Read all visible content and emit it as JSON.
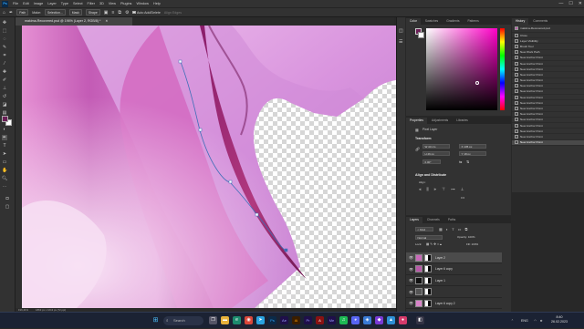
{
  "app": {
    "logo": "Ps"
  },
  "menu": [
    "File",
    "Edit",
    "Image",
    "Layer",
    "Type",
    "Select",
    "Filter",
    "3D",
    "View",
    "Plugins",
    "Window",
    "Help"
  ],
  "window_controls": {
    "minimize": "—",
    "maximize": "☐",
    "close": "✕"
  },
  "options_bar": {
    "tool_mode": "Path",
    "make_label": "Make:",
    "selection_btn": "Selection...",
    "mask_btn": "Mask",
    "shape_btn": "Shape",
    "auto_add_delete": "Auto Add/Delete",
    "align_edges": "Align Edges"
  },
  "document": {
    "tab_title": "makima-Recovered.psd @ 196% (Layer 2, RGB/8) *",
    "close": "✕"
  },
  "status_bar": {
    "zoom": "196,41%",
    "doc_info": "1863 px x 1613 px (72 ppi)"
  },
  "color_panel": {
    "tabs": [
      "Color",
      "Swatches",
      "Gradients",
      "Patterns"
    ],
    "foreground_color": "#6b1f57",
    "background_color": "#ffffff"
  },
  "history_panel": {
    "tabs": [
      "History",
      "Comments"
    ],
    "snapshot": "makima-Recovered.psd",
    "items": [
      "Close",
      "Layer Visibility",
      "Brush Tool",
      "New Work Path",
      "New Anchor Point",
      "New Anchor Point",
      "New Anchor Point",
      "New Anchor Point",
      "New Anchor Point",
      "New Anchor Point",
      "New Anchor Point",
      "New Anchor Point",
      "New Anchor Point",
      "New Anchor Point",
      "New Anchor Point",
      "New Anchor Point",
      "New Anchor Point",
      "New Anchor Point",
      "New Anchor Point",
      "New Anchor Point"
    ],
    "selected_index": 19
  },
  "properties_panel": {
    "tabs": [
      "Properties",
      "Adjustments",
      "Libraries"
    ],
    "layer_type": "Pixel Layer",
    "transform_label": "Transform",
    "w": "W 43 cm",
    "x": "X 135 px",
    "h": "H 26 px",
    "y": "Y 18 px",
    "angle": "0.00°",
    "align_label": "Align and Distribute",
    "align_sublabel": "Align:"
  },
  "layers_panel": {
    "tabs": [
      "Layers",
      "Channels",
      "Paths"
    ],
    "filter": "Kind",
    "blend_mode": "Normal",
    "opacity": "Opacity: 100%",
    "lock": "Lock:",
    "fill": "Fill: 100%",
    "layers": [
      {
        "name": "Layer 2",
        "selected": true
      },
      {
        "name": "Layer 6 copy",
        "selected": false
      },
      {
        "name": "Layer 1",
        "selected": false
      },
      {
        "name": "",
        "selected": false
      },
      {
        "name": "Layer 6 copy 2",
        "selected": false
      }
    ]
  },
  "taskbar": {
    "search_placeholder": "Search",
    "lang": "ENG",
    "time": "8:40",
    "date": "26.02.2023"
  }
}
